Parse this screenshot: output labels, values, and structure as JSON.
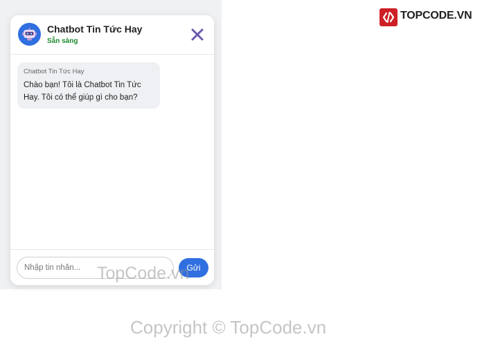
{
  "chatbot": {
    "name": "Chatbot Tin Tức Hay",
    "status": "Sẵn sàng",
    "status_color": "#1c8a2c",
    "accent_color": "#2f6fe0",
    "avatar_icon": "robot-icon",
    "close_icon": "close-icon"
  },
  "messages": [
    {
      "sender": "Chatbot Tin Tức Hay",
      "text": "Chào bạn! Tôi là Chatbot Tin Tức Hay. Tôi có thể giúp gì cho bạn?"
    }
  ],
  "input": {
    "placeholder": "Nhập tin nhắn...",
    "value": ""
  },
  "send_label": "Gửi",
  "logo": {
    "text": "TOPCODE.VN",
    "brand_color": "#cf1f26"
  },
  "watermark": {
    "overlay": "TopCode.vn",
    "footer": "Copyright © TopCode.vn"
  }
}
